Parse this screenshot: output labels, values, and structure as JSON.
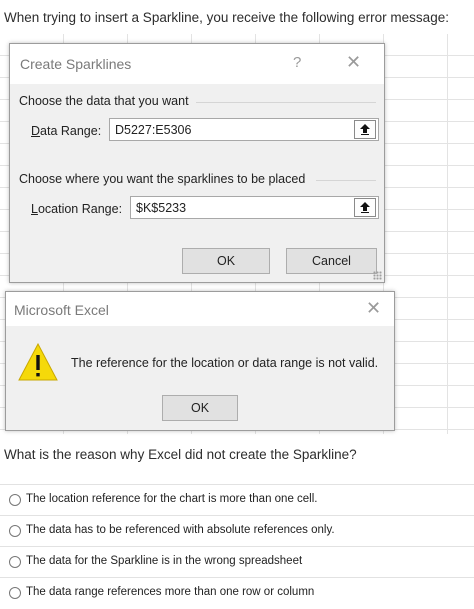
{
  "intro_text": "When trying to insert a Sparkline, you receive the following error message:",
  "create_dialog": {
    "title": "Create Sparklines",
    "help_glyph": "?",
    "close_glyph": "✕",
    "data_group_label": "Choose the data that you want",
    "data_range_label_u": "D",
    "data_range_label_rest": "ata Range:",
    "data_range_value": "D5227:E5306",
    "location_group_label": "Choose where you want the sparklines to be placed",
    "location_range_label_u": "L",
    "location_range_label_rest": "ocation Range:",
    "location_range_value": "$K$5233",
    "collapse_glyph": "🠅",
    "ok_label": "OK",
    "cancel_label": "Cancel"
  },
  "error_dialog": {
    "title": "Microsoft Excel",
    "close_glyph": "✕",
    "icon": "warning-icon",
    "message": "The reference for the location or data range is not valid.",
    "ok_label": "OK"
  },
  "question": "What is the reason why Excel did not create the Sparkline?",
  "options": [
    {
      "label": "The location reference for the chart is more than one cell."
    },
    {
      "label": "The data has to be referenced with absolute references only."
    },
    {
      "label": "The data for the Sparkline is in the wrong spreadsheet"
    },
    {
      "label": "The data range references more than one row or column"
    }
  ]
}
